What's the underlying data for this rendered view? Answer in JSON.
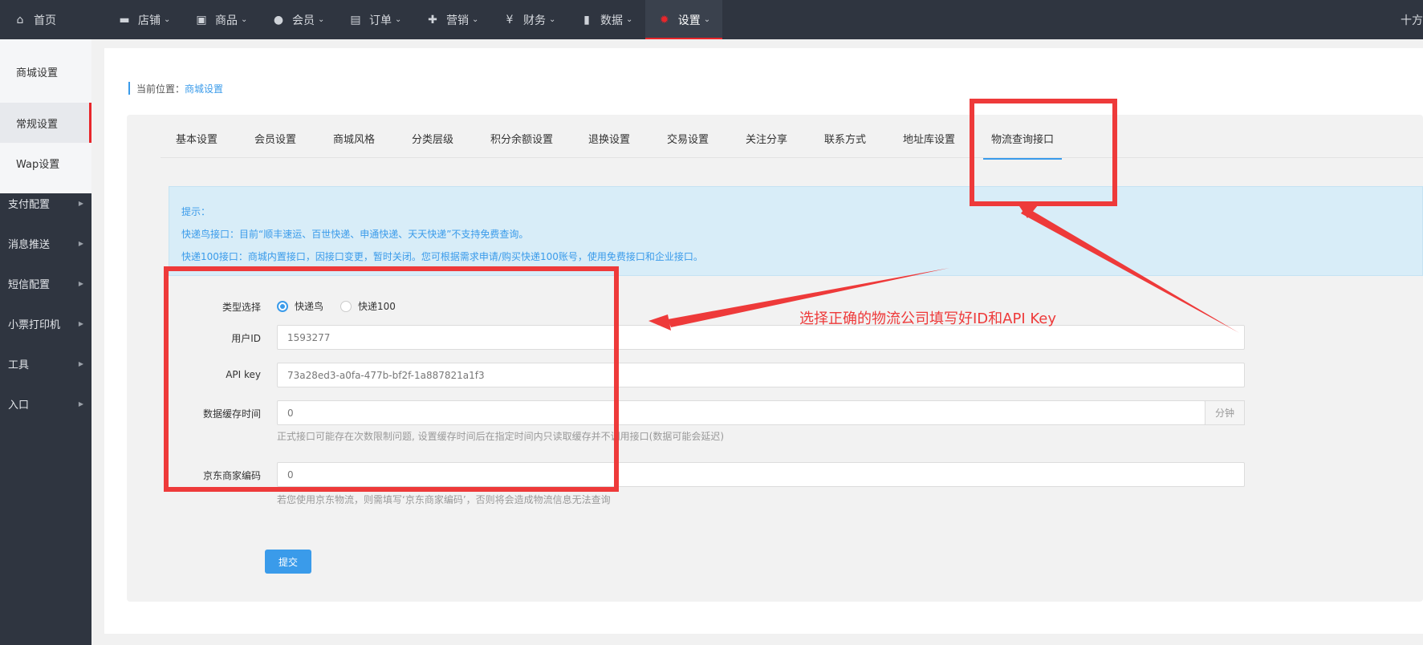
{
  "top_nav": {
    "items": [
      {
        "label": "首页",
        "icon": "home-icon",
        "glyph": "⌂"
      },
      {
        "label": "店铺",
        "icon": "store-icon",
        "glyph": "▬"
      },
      {
        "label": "商品",
        "icon": "product-icon",
        "glyph": "▣"
      },
      {
        "label": "会员",
        "icon": "member-icon",
        "glyph": "●"
      },
      {
        "label": "订单",
        "icon": "order-icon",
        "glyph": "▤"
      },
      {
        "label": "营销",
        "icon": "marketing-icon",
        "glyph": "✚"
      },
      {
        "label": "财务",
        "icon": "finance-icon",
        "glyph": "¥"
      },
      {
        "label": "数据",
        "icon": "data-icon",
        "glyph": "▮"
      },
      {
        "label": "设置",
        "icon": "settings-gear-icon",
        "glyph": "✹"
      }
    ],
    "right_text": "十方"
  },
  "sidebar": {
    "sub_items": [
      "商城设置",
      "常规设置",
      "Wap设置"
    ],
    "groups": [
      "支付配置",
      "消息推送",
      "短信配置",
      "小票打印机",
      "工具",
      "入口"
    ]
  },
  "breadcrumb": {
    "prefix": "当前位置：",
    "current": "商城设置"
  },
  "tabs": [
    "基本设置",
    "会员设置",
    "商城风格",
    "分类层级",
    "积分余额设置",
    "退换设置",
    "交易设置",
    "关注分享",
    "联系方式",
    "地址库设置",
    "物流查询接口"
  ],
  "tip": {
    "title": "提示：",
    "line1": "快递鸟接口：目前“顺丰速运、百世快递、申通快递、天天快递”不支持免费查询。",
    "line2": "快递100接口：商城内置接口，因接口变更，暂时关闭。您可根据需求申请/购买快递100账号，使用免费接口和企业接口。"
  },
  "form": {
    "type_label": "类型选择",
    "type_options": [
      "快递鸟",
      "快递100"
    ],
    "type_selected": "快递鸟",
    "user_id_label": "用户ID",
    "user_id_value": "1593277",
    "api_key_label": "API key",
    "api_key_value": "73a28ed3-a0fa-477b-bf2f-1a887821a1f3",
    "cache_label": "数据缓存时间",
    "cache_value": "0",
    "cache_unit": "分钟",
    "cache_help": "正式接口可能存在次数限制问题, 设置缓存时间后在指定时间内只读取缓存并不调用接口(数据可能会延迟)",
    "jd_label": "京东商家编码",
    "jd_value": "0",
    "jd_help": "若您使用京东物流，则需填写‘京东商家编码’，否则将会造成物流信息无法查询",
    "submit_label": "提交"
  },
  "annotation": {
    "text": "选择正确的物流公司填写好ID和API Key",
    "color": "#ee3a3a"
  }
}
